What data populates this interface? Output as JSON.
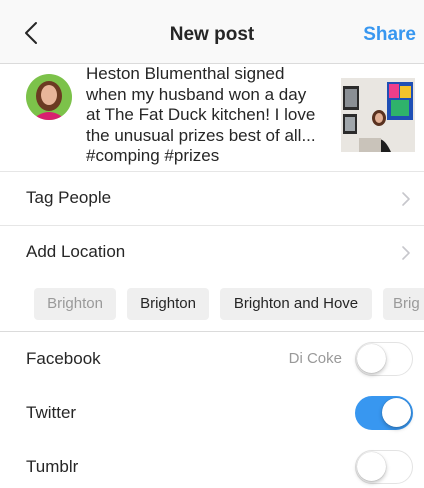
{
  "header": {
    "title": "New post",
    "share_label": "Share"
  },
  "post": {
    "caption": "Heston Blumenthal signed\nwhen my husband won a day\nat The Fat Duck kitchen! I love\nthe unusual prizes best of all...\n#comping #prizes"
  },
  "rows": {
    "tag_people": "Tag People",
    "add_location": "Add Location"
  },
  "location_suggestions": [
    "Brighton",
    "Brighton",
    "Brighton and Hove",
    "Brig"
  ],
  "sharing": {
    "facebook": {
      "label": "Facebook",
      "account": "Di Coke",
      "enabled": false
    },
    "twitter": {
      "label": "Twitter",
      "enabled": true
    },
    "tumblr": {
      "label": "Tumblr",
      "enabled": false
    }
  },
  "colors": {
    "accent": "#3897f0",
    "separator": "#e6e6e6",
    "chip_bg": "#efefef"
  },
  "icons": {
    "back": "chevron-left-icon",
    "row_chevron": "chevron-right-icon"
  }
}
